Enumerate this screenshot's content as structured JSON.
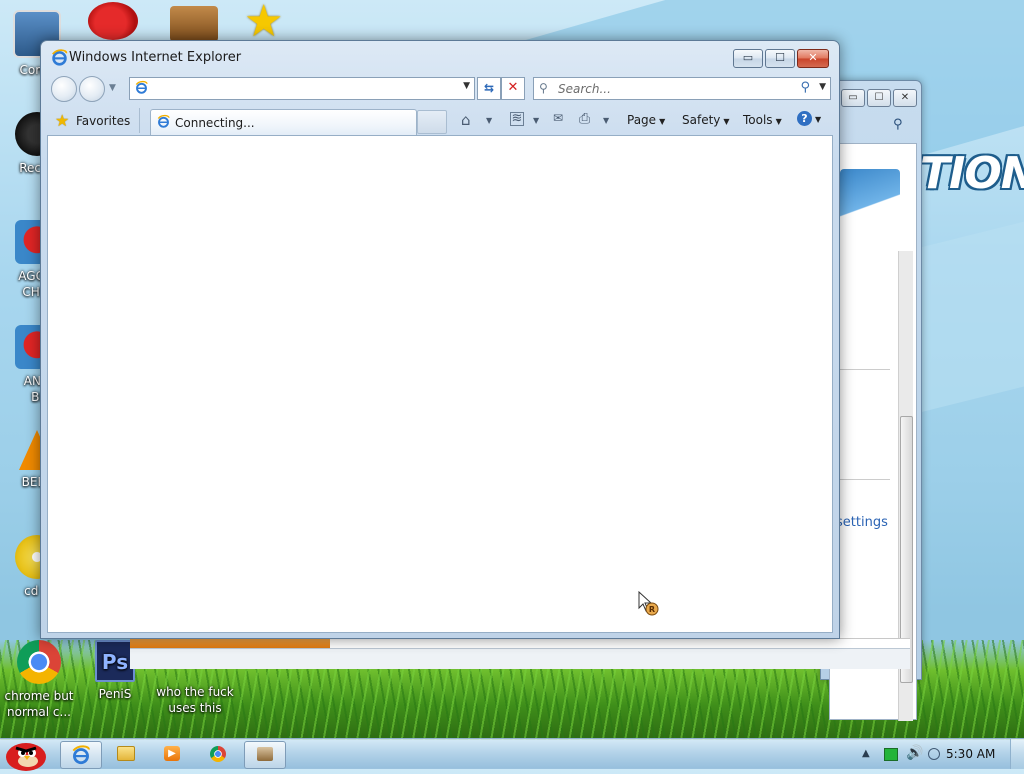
{
  "desktop": {
    "logo_text": "TION",
    "icons": [
      {
        "name": "computer",
        "label": "Comp"
      },
      {
        "name": "recycle-bin",
        "label": "Recyc"
      },
      {
        "name": "aggit-chick",
        "label_line1": "AGGIT",
        "label_line2": "CHIC"
      },
      {
        "name": "angry-birds",
        "label_line1": "ANG",
        "label_line2": "BI"
      },
      {
        "name": "beep",
        "label": "BEEP"
      },
      {
        "name": "cd",
        "label": "cd d"
      },
      {
        "name": "chrome",
        "label_line1": "chrome but",
        "label_line2": "normal c..."
      },
      {
        "name": "photoshop",
        "label": "PeniS"
      },
      {
        "name": "who",
        "label_line1": "who the fuck",
        "label_line2": "uses this"
      }
    ]
  },
  "back_window": {
    "settings_link": "settings"
  },
  "ie_window": {
    "title": "Windows Internet Explorer",
    "controls": {
      "minimize": "▭",
      "maximize": "☐",
      "close": "✕"
    },
    "address": {
      "value": "",
      "placeholder": ""
    },
    "search": {
      "value": "",
      "placeholder": "Search..."
    },
    "favorites_label": "Favorites",
    "tab_label": "Connecting...",
    "commands": {
      "page": "Page",
      "safety": "Safety",
      "tools": "Tools",
      "help": "?"
    },
    "colors": {
      "accent": "#2a63b4",
      "close": "#c9442a"
    }
  },
  "taskbar": {
    "clock": "5:30 AM",
    "items": [
      "ie",
      "explorer",
      "media-player",
      "chrome",
      "app"
    ]
  }
}
